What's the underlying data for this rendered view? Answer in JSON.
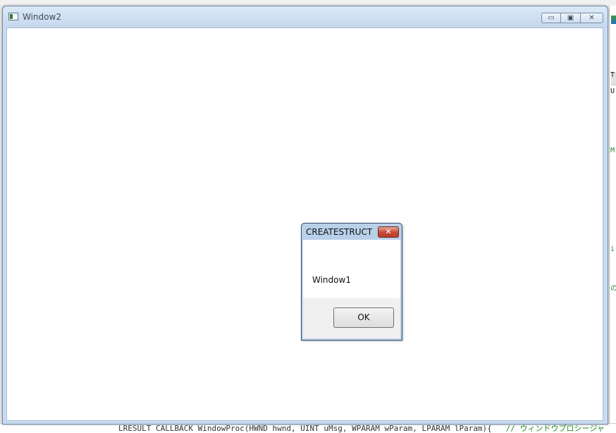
{
  "window": {
    "title": "Window2",
    "minimize_glyph": "▭",
    "maximize_glyph": "▣",
    "close_glyph": "✕"
  },
  "messagebox": {
    "title": "CREATESTRUCT",
    "close_glyph": "✕",
    "text": "Window1",
    "ok_label": "OK"
  },
  "background": {
    "code_line": "LRESULT CALLBACK WindowProc(HWND hwnd, UINT uMsg, WPARAM wParam, LPARAM lParam){",
    "code_comment": "// ウィンドウプロシージャ",
    "right_marks": [
      "T",
      "U",
      "M",
      "i",
      "の"
    ]
  },
  "colors": {
    "titlebar": "#c6d8ee",
    "close_button": "#c64a35",
    "client_bg": "#ffffff"
  }
}
